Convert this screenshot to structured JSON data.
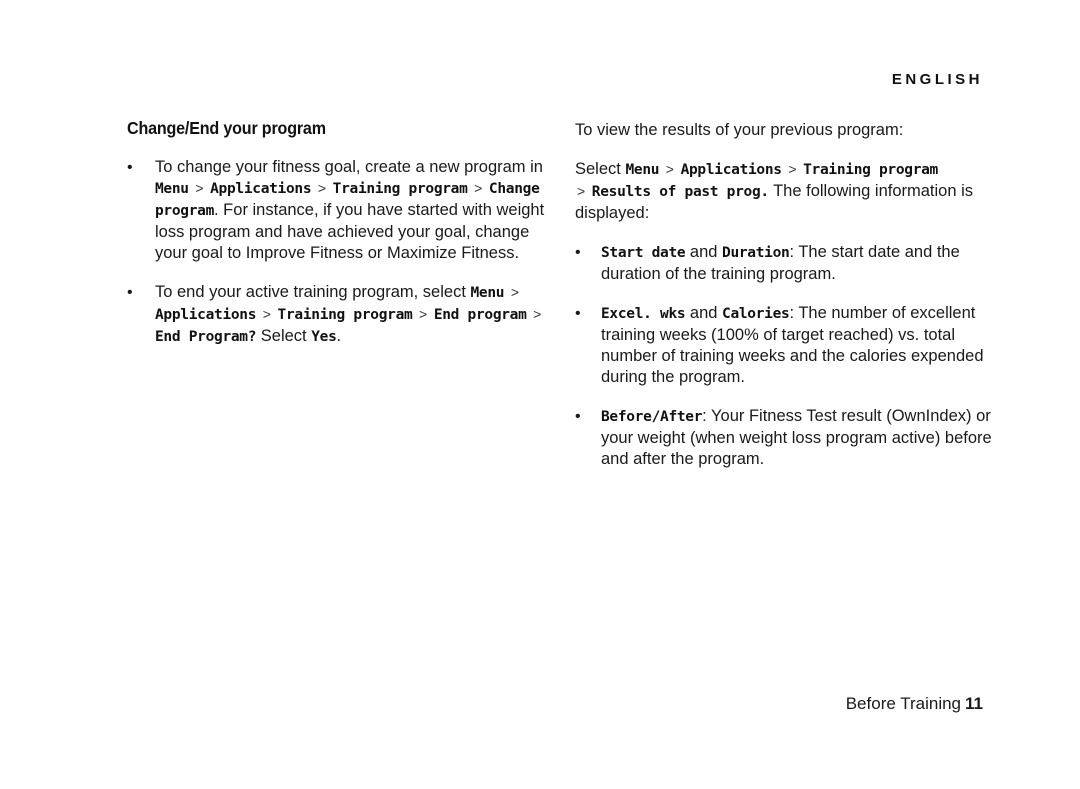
{
  "language_label": "ENGLISH",
  "left": {
    "heading": "Change/End your program",
    "bullet1": {
      "t1": "To change your fitness goal, create a new program in ",
      "m1": "Menu",
      "m2": "Applications",
      "m3": "Training program",
      "m4": "Change program",
      "t2": ". For instance, if you have started with weight loss program and have achieved your goal, change your goal to Improve Fitness or Maximize Fitness."
    },
    "bullet2": {
      "t1": "To end your active training program, select ",
      "m1": "Menu",
      "m2": "Applications",
      "m3": "Training program",
      "m4": "End program",
      "m5": "End Program?",
      "t2": " Select ",
      "m6": "Yes",
      "t3": "."
    }
  },
  "right": {
    "intro": "To view the results of your previous program:",
    "select": {
      "t1": "Select ",
      "m1": "Menu",
      "m2": "Applications",
      "m3": "Training program",
      "m4": "Results of past prog.",
      "t2": " The following information is displayed:"
    },
    "bullets": [
      {
        "m1": "Start date",
        "and": " and ",
        "m2": "Duration",
        "text": ": The start date and the duration of the training program."
      },
      {
        "m1": "Excel. wks",
        "and": " and ",
        "m2": "Calories",
        "text": ": The number of excellent training weeks (100% of target reached) vs. total number of training weeks and the calories expended during the program."
      },
      {
        "m1": "Before/After",
        "text": ": Your Fitness Test result (OwnIndex) or your weight (when weight loss program active) before and after the program."
      }
    ]
  },
  "separator": ">",
  "footer": {
    "section": "Before Training",
    "page": "11"
  }
}
